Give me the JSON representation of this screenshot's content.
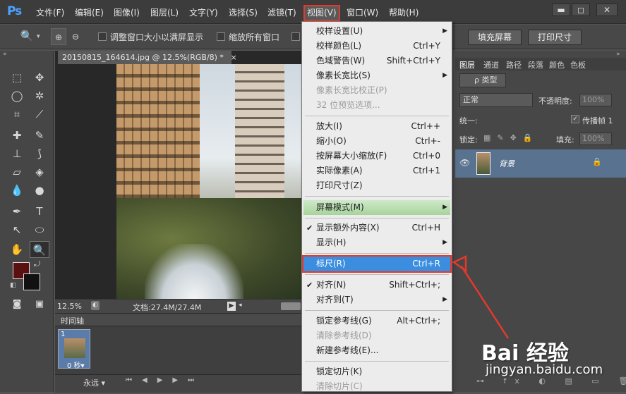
{
  "app": {
    "logo": "Ps"
  },
  "menubar": {
    "items": [
      "文件(F)",
      "编辑(E)",
      "图像(I)",
      "图层(L)",
      "文字(Y)",
      "选择(S)",
      "滤镜(T)",
      "视图(V)",
      "窗口(W)",
      "帮助(H)"
    ],
    "minimize": "▬",
    "restore": "◻",
    "close": "✕"
  },
  "options": {
    "resize_window": "调整窗口大小以满屏显示",
    "zoom_all": "缩放所有窗口",
    "fill_screen": "填充屏幕",
    "print_size": "打印尺寸"
  },
  "document": {
    "tab": "20150815_164614.jpg @ 12.5%(RGB/8) *",
    "close": "×",
    "zoom": "12.5%",
    "doc_info": "文档:27.4M/27.4M"
  },
  "timeline": {
    "title": "时间轴",
    "frame_number": "1",
    "frame_delay": "0 秒▾",
    "loop": "永远 ▾"
  },
  "panels": {
    "tabs": [
      "图层",
      "通道",
      "路径",
      "段落",
      "颜色",
      "色板"
    ],
    "kind": "ρ 类型",
    "blend": "正常",
    "opacity_label": "不透明度:",
    "opacity": "100%",
    "unify_label": "统一:",
    "propagate": "传播帧 1",
    "lock_label": "锁定:",
    "fill_label": "填充:",
    "fill": "100%",
    "layer_name": "背景"
  },
  "view_menu": {
    "rows": [
      {
        "label": "校样设置(U)",
        "shortcut": "",
        "submenu": true,
        "disabled": false,
        "checked": false
      },
      {
        "label": "校样颜色(L)",
        "shortcut": "Ctrl+Y",
        "submenu": false,
        "disabled": false,
        "checked": false
      },
      {
        "label": "色域警告(W)",
        "shortcut": "Shift+Ctrl+Y",
        "submenu": false,
        "disabled": false,
        "checked": false
      },
      {
        "label": "像素长宽比(S)",
        "shortcut": "",
        "submenu": true,
        "disabled": false,
        "checked": false
      },
      {
        "label": "像素长宽比校正(P)",
        "shortcut": "",
        "submenu": false,
        "disabled": true,
        "checked": false
      },
      {
        "label": "32 位预览选项...",
        "shortcut": "",
        "submenu": false,
        "disabled": true,
        "checked": false
      },
      {
        "label": "放大(I)",
        "shortcut": "Ctrl++",
        "submenu": false,
        "disabled": false,
        "checked": false
      },
      {
        "label": "缩小(O)",
        "shortcut": "Ctrl+-",
        "submenu": false,
        "disabled": false,
        "checked": false
      },
      {
        "label": "按屏幕大小缩放(F)",
        "shortcut": "Ctrl+0",
        "submenu": false,
        "disabled": false,
        "checked": false
      },
      {
        "label": "实际像素(A)",
        "shortcut": "Ctrl+1",
        "submenu": false,
        "disabled": false,
        "checked": false
      },
      {
        "label": "打印尺寸(Z)",
        "shortcut": "",
        "submenu": false,
        "disabled": false,
        "checked": false
      },
      {
        "label": "屏幕模式(M)",
        "shortcut": "",
        "submenu": true,
        "disabled": false,
        "checked": false
      },
      {
        "label": "显示额外内容(X)",
        "shortcut": "Ctrl+H",
        "submenu": false,
        "disabled": false,
        "checked": true
      },
      {
        "label": "显示(H)",
        "shortcut": "",
        "submenu": true,
        "disabled": false,
        "checked": false
      },
      {
        "label": "标尺(R)",
        "shortcut": "Ctrl+R",
        "submenu": false,
        "disabled": false,
        "checked": false
      },
      {
        "label": "对齐(N)",
        "shortcut": "Shift+Ctrl+;",
        "submenu": false,
        "disabled": false,
        "checked": true
      },
      {
        "label": "对齐到(T)",
        "shortcut": "",
        "submenu": true,
        "disabled": false,
        "checked": false
      },
      {
        "label": "锁定参考线(G)",
        "shortcut": "Alt+Ctrl+;",
        "submenu": false,
        "disabled": false,
        "checked": false
      },
      {
        "label": "清除参考线(D)",
        "shortcut": "",
        "submenu": false,
        "disabled": true,
        "checked": false
      },
      {
        "label": "新建参考线(E)...",
        "shortcut": "",
        "submenu": false,
        "disabled": false,
        "checked": false
      },
      {
        "label": "锁定切片(K)",
        "shortcut": "",
        "submenu": false,
        "disabled": false,
        "checked": false
      },
      {
        "label": "清除切片(C)",
        "shortcut": "",
        "submenu": false,
        "disabled": true,
        "checked": false
      }
    ]
  },
  "watermark": {
    "brand": "Bai 经验",
    "url": "jingyan.baidu.com"
  },
  "colors": {
    "accent_red": "#e5392b",
    "highlight_blue": "#3b8de0",
    "foreground": "#5a1010",
    "background": "#111111"
  }
}
